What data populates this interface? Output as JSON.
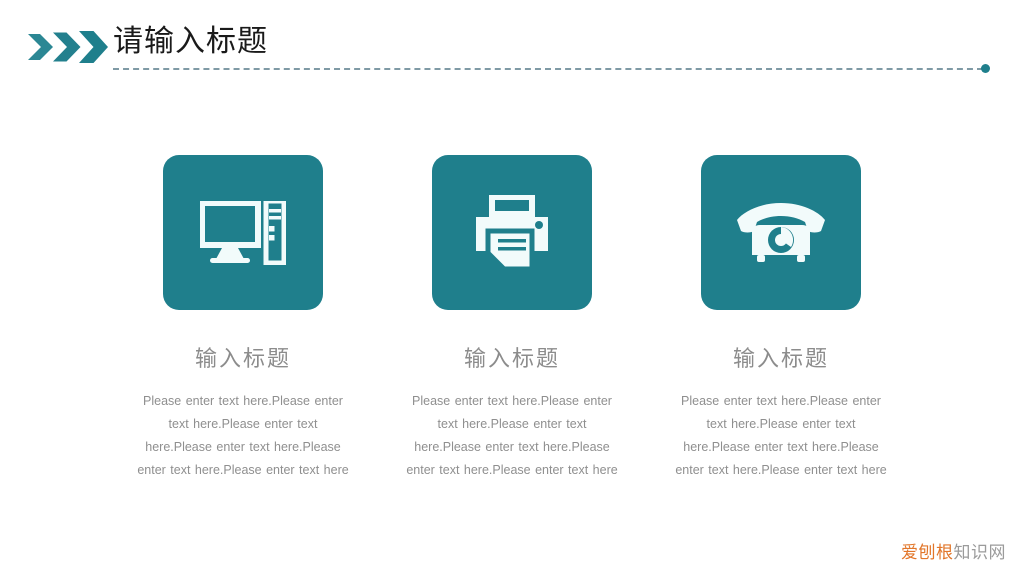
{
  "header": {
    "title": "请输入标题",
    "chevron_icon": "triple-chevron-right-icon",
    "accent_color": "#1f7f8c",
    "rule_color": "#7f9aa5",
    "title_color": "#1a1a1a"
  },
  "columns": [
    {
      "icon": "desktop-computer-icon",
      "title": "输入标题",
      "body": "Please enter text here.Please enter text here.Please enter text here.Please enter text here.Please enter text here.Please enter text here"
    },
    {
      "icon": "printer-icon",
      "title": "输入标题",
      "body": "Please enter text here.Please enter text here.Please enter text here.Please enter text here.Please enter text here.Please enter text here"
    },
    {
      "icon": "telephone-icon",
      "title": "输入标题",
      "body": "Please enter text here.Please enter text here.Please enter text here.Please enter text here.Please enter text here.Please enter text here"
    }
  ],
  "watermark": {
    "part_one": "爱刨根",
    "part_two": "知识网",
    "part_one_color": "#e2762a",
    "part_two_color": "#9b9b9b"
  }
}
